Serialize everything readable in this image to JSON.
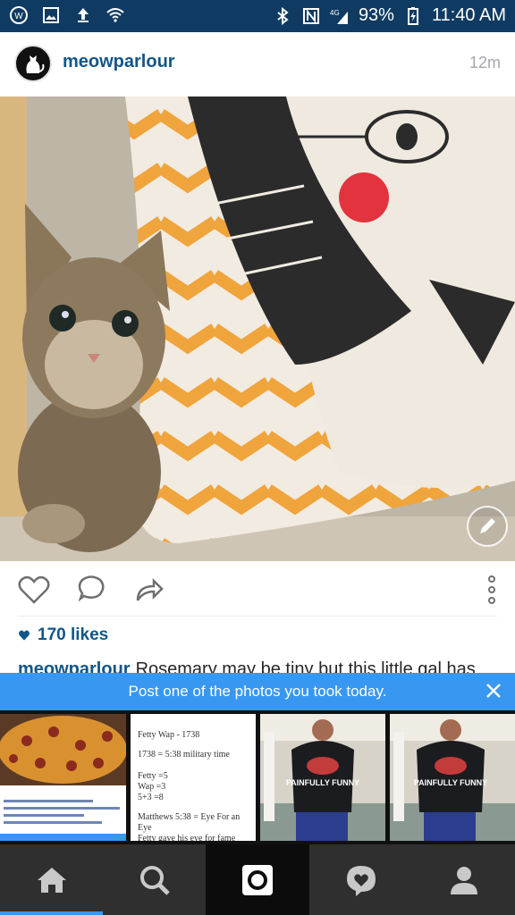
{
  "status_bar": {
    "battery": "93%",
    "time": "11:40 AM"
  },
  "post": {
    "username": "meowparlour",
    "time_ago": "12m",
    "likes": "170 likes",
    "caption_username": "meowparlour",
    "caption_text": "Rosemary may be tiny but this little gal has"
  },
  "banner": {
    "text": "Post one of the photos you took today."
  },
  "thumbnails": {
    "note_lines": [
      "Fetty Wap - 1738",
      "1738 = 5:38 military time",
      "Fetty =5",
      "Wap =3",
      "5+3 =8",
      "Matthews 5:38 = Eye For an",
      "Eye",
      "Fetty gave his eye for fame"
    ],
    "shirt_text": "PAINFULLY FUNNY"
  },
  "tabs": [
    "home-icon",
    "search-icon",
    "camera-icon",
    "activity-icon",
    "profile-icon"
  ]
}
